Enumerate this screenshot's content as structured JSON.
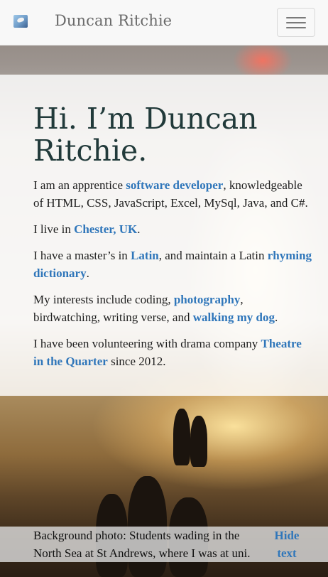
{
  "navbar": {
    "brand_name": "Duncan Ritchie",
    "logo_icon": "bird-logo-icon",
    "toggle_icon": "hamburger-menu-icon"
  },
  "main": {
    "heading": "Hi. I’m Duncan Ritchie.",
    "intro": {
      "t1": "I am an apprentice ",
      "link1": "software developer",
      "t2": ", knowledgeable of HTML, CSS, JavaScript, Excel, MySql, Java, and C#."
    },
    "live": {
      "t1": "I live in ",
      "link1": "Chester, UK",
      "t2": "."
    },
    "masters": {
      "t1": "I have a master’s in ",
      "link1": "Latin",
      "t2": ", and maintain a Latin ",
      "link2": "rhyming dictionary",
      "t3": "."
    },
    "interests": {
      "t1": "My interests include coding, ",
      "link1": "photography",
      "t2": ", birdwatching, writing verse, and ",
      "link2": "walking my dog",
      "t3": "."
    },
    "volunteer": {
      "t1": "I have been volunteering with drama company ",
      "link1": "Theatre in the Quarter",
      "t2": " since 2012."
    }
  },
  "caption": {
    "text": "Background photo: Students wading in the North Sea at St Andrews, where I was at uni.",
    "hide_label": "Hide text"
  },
  "colors": {
    "link": "#2f76ba",
    "heading": "#213a3a",
    "navbar_bg": "#f8f8f8"
  }
}
